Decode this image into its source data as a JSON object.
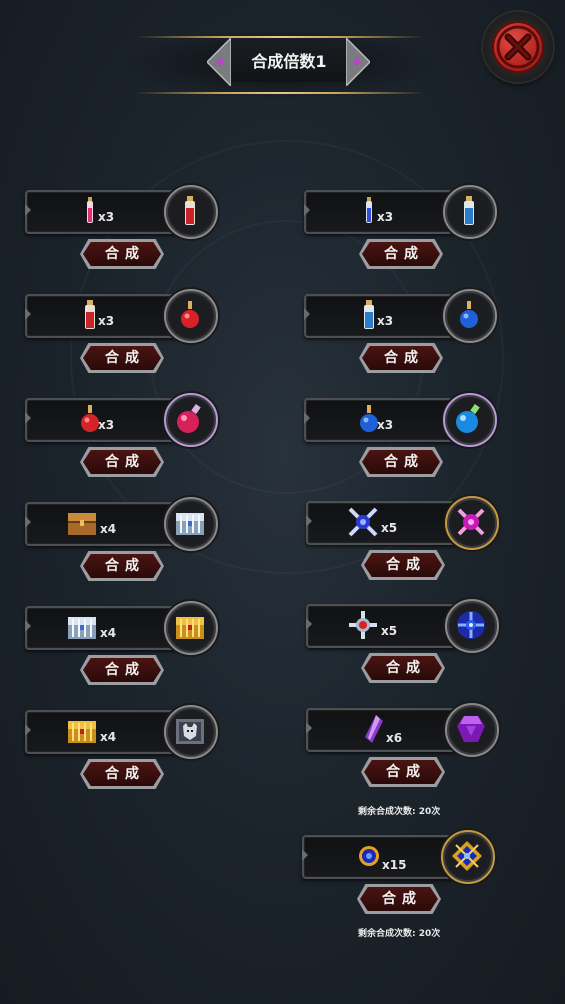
{
  "header": {
    "title": "合成倍数1"
  },
  "close_button": {
    "icon": "close-x-icon"
  },
  "recipes": [
    {
      "source_icon": "small-red-vial-icon",
      "qty": "x3",
      "target_icon": "red-potion-bottle-icon",
      "button": "合成"
    },
    {
      "source_icon": "small-blue-vial-icon",
      "qty": "x3",
      "target_icon": "blue-potion-bottle-icon",
      "button": "合成"
    },
    {
      "source_icon": "red-potion-bottle-icon",
      "qty": "x3",
      "target_icon": "red-round-flask-icon",
      "button": "合成"
    },
    {
      "source_icon": "blue-potion-bottle-icon",
      "qty": "x3",
      "target_icon": "blue-round-flask-icon",
      "button": "合成"
    },
    {
      "source_icon": "red-round-flask-icon",
      "qty": "x3",
      "target_icon": "large-red-flask-icon",
      "button": "合成"
    },
    {
      "source_icon": "blue-round-flask-icon",
      "qty": "x3",
      "target_icon": "large-blue-flask-icon",
      "button": "合成"
    },
    {
      "source_icon": "wooden-chest-icon",
      "qty": "x4",
      "target_icon": "silver-chest-icon",
      "button": "合成"
    },
    {
      "source_icon": "blue-cross-emblem-icon",
      "qty": "x5",
      "target_icon": "pink-cross-emblem-icon",
      "button": "合成"
    },
    {
      "source_icon": "silver-chest-icon",
      "qty": "x4",
      "target_icon": "golden-chest-icon",
      "button": "合成"
    },
    {
      "source_icon": "red-cross-emblem-icon",
      "qty": "x5",
      "target_icon": "blue-rune-emblem-icon",
      "button": "合成"
    },
    {
      "source_icon": "golden-chest-icon",
      "qty": "x4",
      "target_icon": "wolf-emblem-chest-icon",
      "button": "合成"
    },
    {
      "source_icon": "purple-crystal-icon",
      "qty": "x6",
      "target_icon": "purple-gem-icon",
      "button": "合成"
    },
    {
      "source_icon": "gold-ring-orb-icon",
      "qty": "x15",
      "target_icon": "gold-star-emblem-icon",
      "button": "合成"
    }
  ],
  "remaining_texts": [
    "剩余合成次数: 20次",
    "剩余合成次数: 20次"
  ]
}
